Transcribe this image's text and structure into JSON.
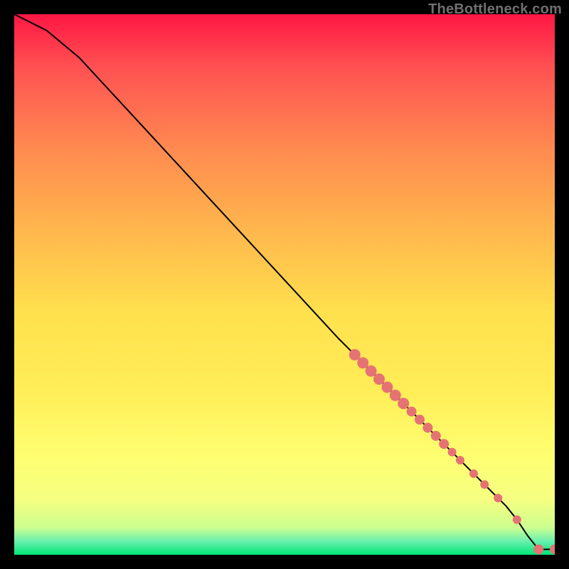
{
  "watermark": "TheBottleneck.com",
  "colors": {
    "marker_fill": "#e57373",
    "line_stroke": "#000000",
    "gradient_stops": [
      "#ff1744",
      "#ff5252",
      "#ff8a50",
      "#ffb74d",
      "#ffe04d",
      "#ffee58",
      "#ffff72",
      "#f4ff81",
      "#ccff90",
      "#69f0ae",
      "#00e676"
    ]
  },
  "chart_data": {
    "type": "line",
    "title": "",
    "xlabel": "",
    "ylabel": "",
    "xlim": [
      0,
      100
    ],
    "ylim": [
      0,
      100
    ],
    "series": [
      {
        "name": "bottleneck-curve",
        "x": [
          0,
          6,
          12,
          18,
          24,
          30,
          36,
          42,
          48,
          54,
          60,
          63,
          65,
          67,
          69,
          71,
          73,
          75,
          77,
          79,
          81,
          83,
          85,
          87,
          89,
          91,
          93,
          95,
          97,
          100
        ],
        "y": [
          100,
          97,
          92,
          85.5,
          79,
          72.5,
          66,
          59.5,
          53,
          46.5,
          40,
          37,
          35,
          33,
          31,
          29,
          27,
          25,
          23,
          21,
          19,
          17,
          15,
          13,
          11,
          9,
          6.5,
          3.5,
          1,
          1
        ]
      }
    ],
    "markers": {
      "name": "highlighted-points",
      "x": [
        63,
        64.5,
        66,
        67.5,
        69,
        70.5,
        72,
        73.5,
        75,
        76.5,
        78,
        79.5,
        81,
        82.5,
        85,
        87,
        89.5,
        93,
        97,
        100
      ],
      "y": [
        37,
        35.5,
        34,
        32.5,
        31,
        29.5,
        28,
        26.5,
        25,
        23.5,
        22,
        20.5,
        19,
        17.5,
        15,
        13,
        10.5,
        6.5,
        1,
        1
      ],
      "r": [
        8,
        8,
        8,
        8,
        8,
        8,
        8,
        7,
        7,
        7,
        7,
        7,
        6,
        6,
        6,
        6,
        6,
        6,
        7,
        7
      ]
    }
  }
}
